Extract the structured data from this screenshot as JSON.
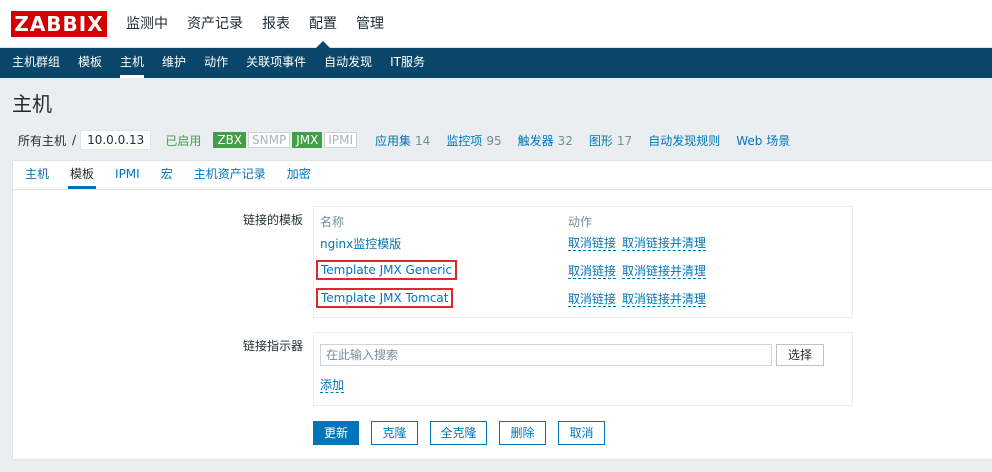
{
  "header": {
    "logo": "ZABBIX",
    "menu": [
      "监测中",
      "资产记录",
      "报表",
      "配置",
      "管理"
    ]
  },
  "subnav": [
    "主机群组",
    "模板",
    "主机",
    "维护",
    "动作",
    "关联项事件",
    "自动发现",
    "IT服务"
  ],
  "page": {
    "title": "主机"
  },
  "breadcrumb": {
    "all_hosts": "所有主机",
    "sep": "/",
    "current": "10.0.0.13",
    "enabled": "已启用",
    "tags": [
      "ZBX",
      "SNMP",
      "JMX",
      "IPMI"
    ],
    "links": [
      {
        "label": "应用集",
        "count": "14"
      },
      {
        "label": "监控项",
        "count": "95"
      },
      {
        "label": "触发器",
        "count": "32"
      },
      {
        "label": "图形",
        "count": "17"
      },
      {
        "label": "自动发现规则",
        "count": ""
      },
      {
        "label": "Web 场景",
        "count": ""
      }
    ]
  },
  "tabs": [
    "主机",
    "模板",
    "IPMI",
    "宏",
    "主机资产记录",
    "加密"
  ],
  "linked": {
    "label": "链接的模板",
    "col_name": "名称",
    "col_action": "动作",
    "templates": [
      "nginx监控模版",
      "Template JMX Generic",
      "Template JMX Tomcat"
    ],
    "unlink": "取消链接",
    "unlink_clear": "取消链接并清理"
  },
  "indicator": {
    "label": "链接指示器",
    "placeholder": "在此输入搜索",
    "select": "选择",
    "add": "添加"
  },
  "buttons": {
    "update": "更新",
    "clone": "克隆",
    "full_clone": "全克隆",
    "delete": "删除",
    "cancel": "取消"
  }
}
